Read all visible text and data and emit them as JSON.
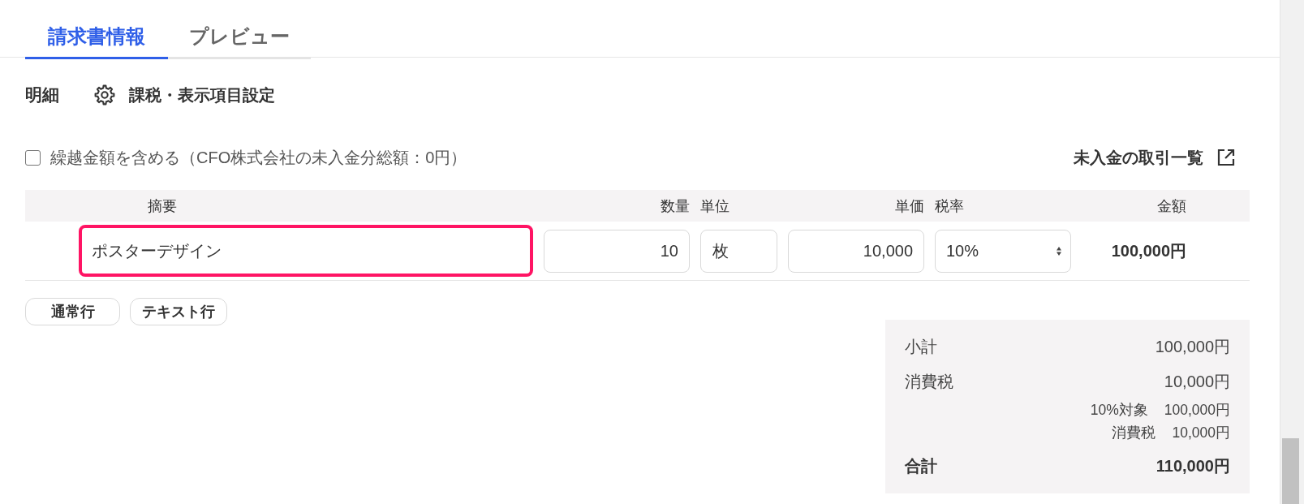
{
  "tabs": [
    {
      "label": "請求書情報",
      "selected": true
    },
    {
      "label": "プレビュー",
      "selected": false
    }
  ],
  "section": {
    "title": "明細",
    "settings_link": "課税・表示項目設定"
  },
  "carryover": {
    "label": "繰越金額を含める（CFO株式会社の未入金分総額：0円）",
    "checked": false
  },
  "unpaid_link": "未入金の取引一覧",
  "table": {
    "columns": [
      "摘要",
      "数量",
      "単位",
      "単価",
      "税率",
      "金額"
    ],
    "rows": [
      {
        "description": "ポスターデザイン",
        "focused": true,
        "quantity": "10",
        "unit": "枚",
        "unit_price": "10,000",
        "tax_rate": "10%",
        "amount": "100,000円"
      }
    ]
  },
  "add_buttons": [
    "通常行",
    "テキスト行"
  ],
  "summary": [
    {
      "kind": "main",
      "label": "小計",
      "value": "100,000円"
    },
    {
      "kind": "main",
      "label": "消費税",
      "value": "10,000円"
    },
    {
      "kind": "detail",
      "label": "10%対象",
      "value": "100,000円"
    },
    {
      "kind": "detail",
      "label": "消費税",
      "value": "10,000円"
    },
    {
      "kind": "total",
      "label": "合計",
      "value": "110,000円"
    }
  ]
}
